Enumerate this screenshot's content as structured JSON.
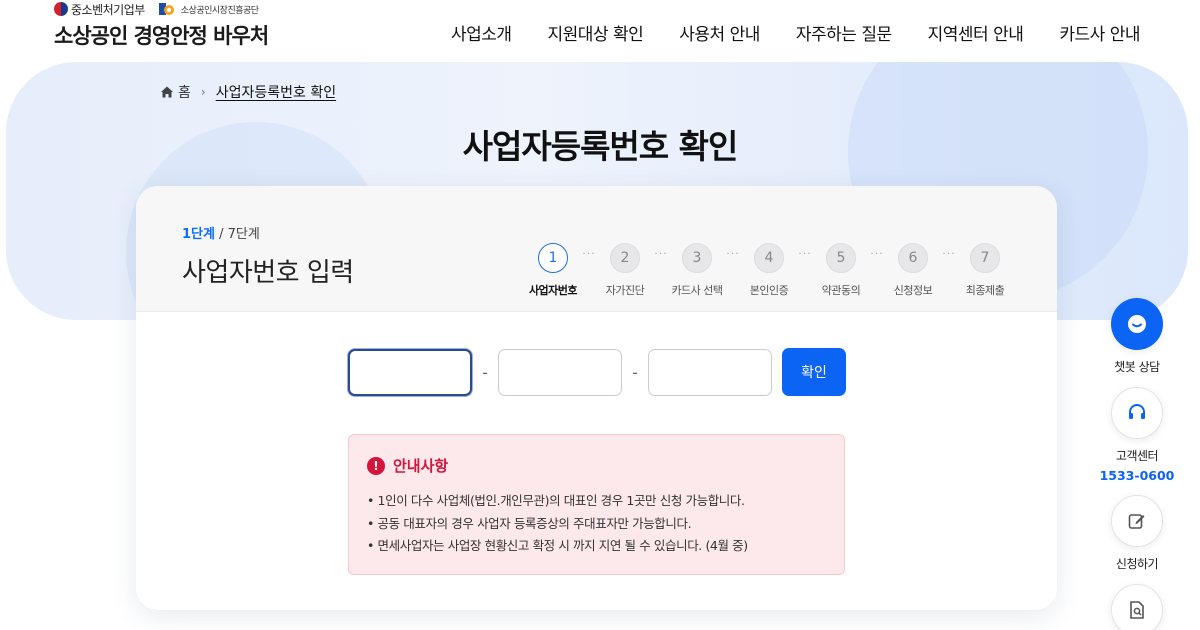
{
  "header": {
    "ministry": "중소벤처기업부",
    "agency": "소상공인시장진흥공단",
    "site_title": "소상공인 경영안정 바우처",
    "nav": [
      "사업소개",
      "지원대상 확인",
      "사용처 안내",
      "자주하는 질문",
      "지역센터 안내",
      "카드사 안내"
    ]
  },
  "breadcrumb": {
    "home": "홈",
    "current": "사업자등록번호 확인"
  },
  "page_title": "사업자등록번호 확인",
  "card": {
    "step_current": "1단계",
    "step_total": " / 7단계",
    "heading": "사업자번호 입력",
    "steps": [
      {
        "num": "1",
        "label": "사업자번호"
      },
      {
        "num": "2",
        "label": "자가진단"
      },
      {
        "num": "3",
        "label": "카드사 선택"
      },
      {
        "num": "4",
        "label": "본인인증"
      },
      {
        "num": "5",
        "label": "약관동의"
      },
      {
        "num": "6",
        "label": "신청정보"
      },
      {
        "num": "7",
        "label": "최종제출"
      }
    ],
    "dots": "···",
    "dash": "-",
    "input_values": [
      "",
      "",
      ""
    ],
    "confirm_label": "확인"
  },
  "notice": {
    "title": "안내사항",
    "icon": "!",
    "items": [
      "1인이 다수 사업체(법인.개인무관)의 대표인 경우 1곳만 신청 가능합니다.",
      "공동 대표자의 경우 사업자 등록증상의 주대표자만 가능합니다.",
      "면세사업자는 사업장 현황신고 확정 시 까지 지연 될 수 있습니다. (4월 중)"
    ]
  },
  "quick_menu": {
    "chatbot": "챗봇 상담",
    "customer_center": "고객센터",
    "phone": "1533-0600",
    "apply": "신청하기"
  },
  "colors": {
    "accent": "#0b64f4",
    "notice_red": "#d6143b",
    "notice_bg": "#fde9ec"
  }
}
